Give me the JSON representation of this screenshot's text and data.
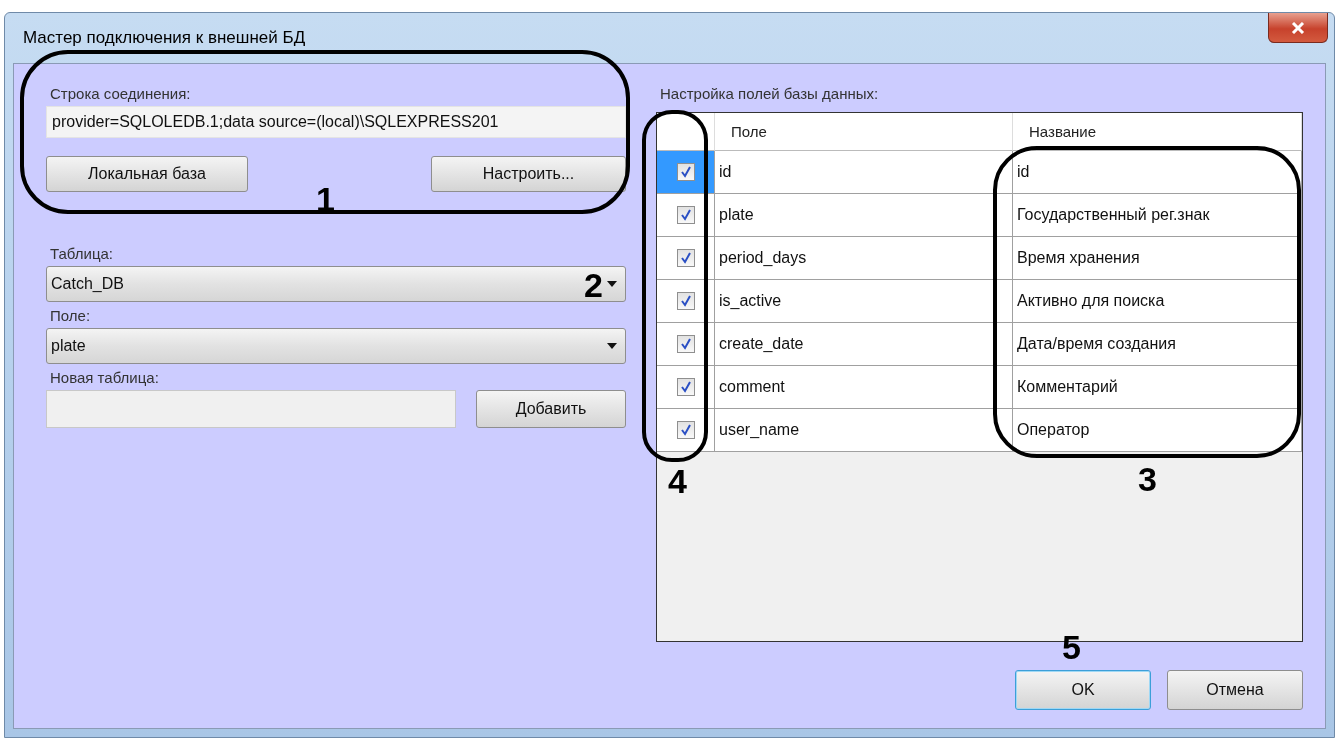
{
  "window": {
    "title": "Мастер подключения к внешней БД"
  },
  "connection": {
    "label": "Строка соединения:",
    "value": "provider=SQLOLEDB.1;data source=(local)\\SQLEXPRESS201",
    "buttons": [
      "Локальная база",
      "Настроить..."
    ]
  },
  "table_select": {
    "label": "Таблица:",
    "value": "Catch_DB"
  },
  "field_select": {
    "label": "Поле:",
    "value": "plate"
  },
  "new_table": {
    "label": "Новая таблица:",
    "button": "Добавить"
  },
  "grid": {
    "label": "Настройка полей базы данных:",
    "columns": [
      "Поле",
      "Название"
    ],
    "rows": [
      {
        "field": "id",
        "name": "id",
        "checked": true,
        "selected": true
      },
      {
        "field": "plate",
        "name": "Государственный рег.знак",
        "checked": true,
        "selected": false
      },
      {
        "field": "period_days",
        "name": "Время хранения",
        "checked": true,
        "selected": false
      },
      {
        "field": "is_active",
        "name": "Активно для поиска",
        "checked": true,
        "selected": false
      },
      {
        "field": "create_date",
        "name": "Дата/время создания",
        "checked": true,
        "selected": false
      },
      {
        "field": "comment",
        "name": "Комментарий",
        "checked": true,
        "selected": false
      },
      {
        "field": "user_name",
        "name": "Оператор",
        "checked": true,
        "selected": false
      }
    ]
  },
  "buttons": [
    {
      "label": "OK",
      "default": true
    },
    {
      "label": "Отмена",
      "default": false
    }
  ],
  "annotations": [
    "1",
    "2",
    "3",
    "4",
    "5"
  ]
}
